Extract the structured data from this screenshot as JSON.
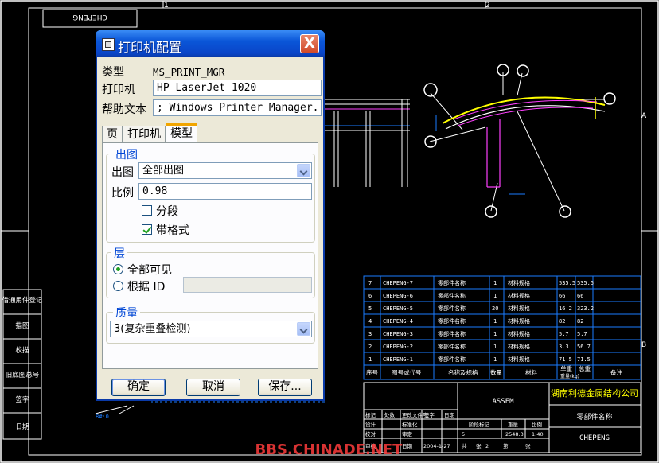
{
  "drawing": {
    "zone_numbers": [
      "1",
      "2"
    ],
    "zone_letters": [
      "A",
      "B"
    ],
    "title_label": "CHEPENG",
    "watermark": "BBS.CHINADE.NET",
    "side_panel": [
      "借通用件登记",
      "描图",
      "校描",
      "旧底图总号",
      "签字",
      "日期"
    ],
    "parts_table": {
      "rows": [
        {
          "idx": "7",
          "code": "CHEPENG-7",
          "name": "零部件名称",
          "qty": "1",
          "mat": "材料规格",
          "w1": "535.5",
          "w2": "535.5"
        },
        {
          "idx": "6",
          "code": "CHEPENG-6",
          "name": "零部件名称",
          "qty": "1",
          "mat": "材料规格",
          "w1": "66",
          "w2": "66"
        },
        {
          "idx": "5",
          "code": "CHEPENG-5",
          "name": "零部件名称",
          "qty": "20",
          "mat": "材料规格",
          "w1": "16.2",
          "w2": "323.2"
        },
        {
          "idx": "4",
          "code": "CHEPENG-4",
          "name": "零部件名称",
          "qty": "1",
          "mat": "材料规格",
          "w1": "82",
          "w2": "82"
        },
        {
          "idx": "3",
          "code": "CHEPENG-3",
          "name": "零部件名称",
          "qty": "1",
          "mat": "材料规格",
          "w1": "5.7",
          "w2": "5.7"
        },
        {
          "idx": "2",
          "code": "CHEPENG-2",
          "name": "零部件名称",
          "qty": "1",
          "mat": "材料规格",
          "w1": "3.3",
          "w2": "56.7"
        },
        {
          "idx": "1",
          "code": "CHEPENG-1",
          "name": "零部件名称",
          "qty": "1",
          "mat": "材料规格",
          "w1": "71.5",
          "w2": "71.5"
        }
      ],
      "header": [
        "序号",
        "图号或代号",
        "名称及规格",
        "数量",
        "材料",
        "单重",
        "总重",
        "备注"
      ],
      "weight_caption": "重量(kg)"
    },
    "title_block": {
      "company": "湖南利德金属结构公司",
      "assembly": "ASSEM",
      "part_name": "零部件名称",
      "drawing_no": "CHEPENG",
      "sign_row1": [
        "标记",
        "处数",
        "更改文件号",
        "签字",
        "日期"
      ],
      "sign_row2": [
        "设计",
        "标准化"
      ],
      "sign_row3": [
        "校对",
        "审定"
      ],
      "sign_row4": [
        "审核",
        "日期"
      ],
      "stage_header": [
        "阶段标记",
        "重量",
        "比例"
      ],
      "weight": "2548.3",
      "scale": "1:40",
      "sheet_row": [
        "共",
        "张",
        "第",
        "张"
      ],
      "sheet_total": "5",
      "sheet_no": "2",
      "date_value": "2004-1-27"
    }
  },
  "dialog": {
    "title": "打印机配置",
    "close_label": "X",
    "type_label": "类型",
    "type_value": "MS_PRINT_MGR",
    "printer_label": "打印机",
    "printer_value": "HP LaserJet 1020",
    "help_label": "帮助文本",
    "help_value": "; Windows Printer Manager.",
    "tabs": [
      "页",
      "打印机",
      "模型"
    ],
    "output_group": "出图",
    "output_label": "出图",
    "output_value": "全部出图",
    "scale_label": "比例",
    "scale_value": "0.98",
    "segment_label": "分段",
    "frame_label": "带格式",
    "layer_group": "层",
    "layer_all": "全部可见",
    "layer_by_id": "根据 ID",
    "quality_group": "质量",
    "quality_value": "3(复杂重叠检测)",
    "ok": "确定",
    "cancel": "取消",
    "save": "保存..."
  },
  "colors": {
    "cad_background": "#000000",
    "cad_lines": "#ffffff",
    "cad_blue": "#1a7cff",
    "cad_yellow": "#ffff00",
    "cad_magenta": "#ff40ff",
    "watermark": "#ff3c3c",
    "dialog_title": "#0a56d8"
  }
}
